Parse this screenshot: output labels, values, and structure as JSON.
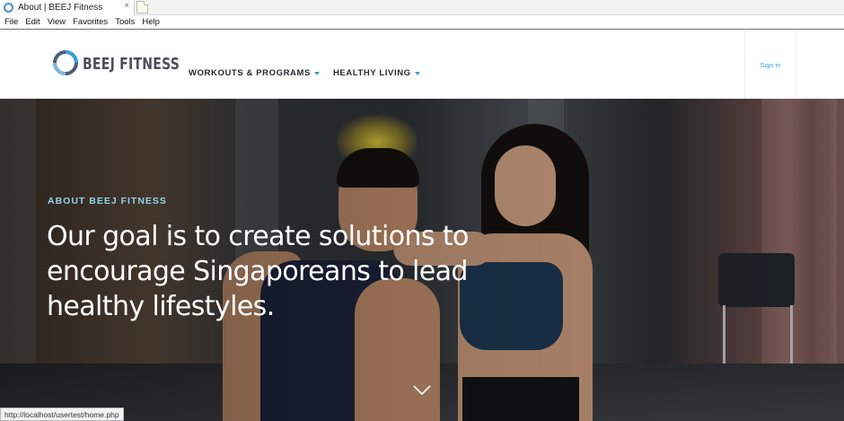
{
  "browser": {
    "tab_title": "About | BEEJ Fitness",
    "tab_close": "×",
    "menu": [
      "File",
      "Edit",
      "View",
      "Favorites",
      "Tools",
      "Help"
    ],
    "status_url": "http://localhost/usertest/home.php"
  },
  "site": {
    "logo_text": "BEEJ FITNESS",
    "nav": [
      {
        "label": "WORKOUTS & PROGRAMS",
        "has_dropdown": true
      },
      {
        "label": "HEALTHY LIVING",
        "has_dropdown": true
      }
    ],
    "signin_label": "Sign in",
    "accent_color": "#3aa0d6"
  },
  "hero": {
    "eyebrow": "ABOUT BEEJ FITNESS",
    "eyebrow_color": "#8fd3ea",
    "title": "Our goal is to create solutions to encourage Singaporeans to lead healthy lifestyles.",
    "scroll_icon": "chevron-down-icon"
  }
}
